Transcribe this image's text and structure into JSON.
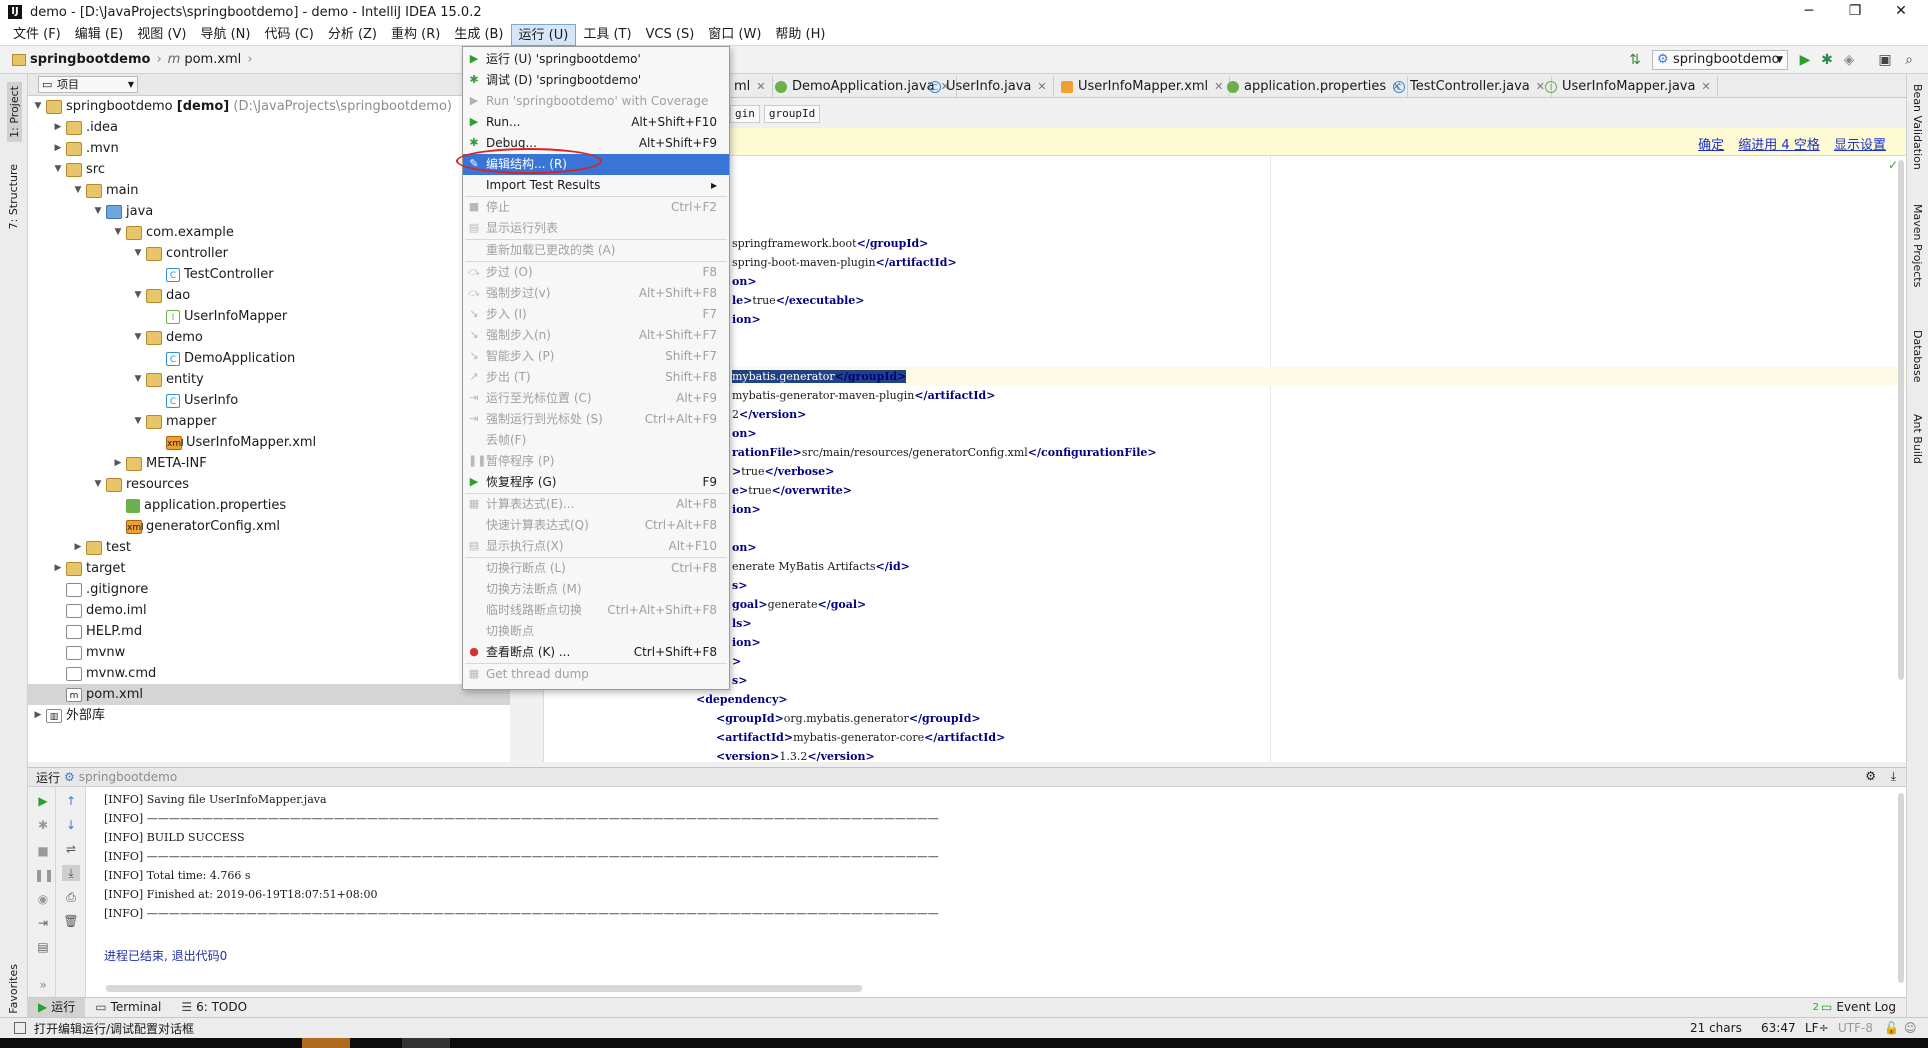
{
  "window": {
    "title": "demo - [D:\\JavaProjects\\springbootdemo] - demo - IntelliJ IDEA 15.0.2",
    "minimize": "─",
    "maximize": "❐",
    "close": "✕"
  },
  "menubar": [
    "文件 (F)",
    "编辑 (E)",
    "视图 (V)",
    "导航 (N)",
    "代码 (C)",
    "分析 (Z)",
    "重构 (R)",
    "生成 (B)",
    "运行 (U)",
    "工具 (T)",
    "VCS (S)",
    "窗口 (W)",
    "帮助 (H)"
  ],
  "navbar": {
    "project": "springbootdemo",
    "file_icon": "m",
    "file": "pom.xml",
    "run_config": "springbootdemo"
  },
  "project_panel": {
    "header": "项目",
    "root_name": "springbootdemo",
    "root_module": "[demo]",
    "root_path": "(D:\\JavaProjects\\springbootdemo)",
    "items": [
      {
        "label": ".idea",
        "depth": 1,
        "arrow": "▶",
        "icon": "folder"
      },
      {
        "label": ".mvn",
        "depth": 1,
        "arrow": "▶",
        "icon": "folder"
      },
      {
        "label": "src",
        "depth": 1,
        "arrow": "▼",
        "icon": "folder"
      },
      {
        "label": "main",
        "depth": 2,
        "arrow": "▼",
        "icon": "folder"
      },
      {
        "label": "java",
        "depth": 3,
        "arrow": "▼",
        "icon": "folder-blue"
      },
      {
        "label": "com.example",
        "depth": 4,
        "arrow": "▼",
        "icon": "folder"
      },
      {
        "label": "controller",
        "depth": 5,
        "arrow": "▼",
        "icon": "folder"
      },
      {
        "label": "TestController",
        "depth": 6,
        "arrow": "",
        "icon": "class"
      },
      {
        "label": "dao",
        "depth": 5,
        "arrow": "▼",
        "icon": "folder"
      },
      {
        "label": "UserInfoMapper",
        "depth": 6,
        "arrow": "",
        "icon": "interface"
      },
      {
        "label": "demo",
        "depth": 5,
        "arrow": "▼",
        "icon": "folder"
      },
      {
        "label": "DemoApplication",
        "depth": 6,
        "arrow": "",
        "icon": "class"
      },
      {
        "label": "entity",
        "depth": 5,
        "arrow": "▼",
        "icon": "folder"
      },
      {
        "label": "UserInfo",
        "depth": 6,
        "arrow": "",
        "icon": "class"
      },
      {
        "label": "mapper",
        "depth": 5,
        "arrow": "▼",
        "icon": "folder"
      },
      {
        "label": "UserInfoMapper.xml",
        "depth": 6,
        "arrow": "",
        "icon": "xml"
      },
      {
        "label": "META-INF",
        "depth": 4,
        "arrow": "▶",
        "icon": "folder"
      },
      {
        "label": "resources",
        "depth": 3,
        "arrow": "▼",
        "icon": "folder"
      },
      {
        "label": "application.properties",
        "depth": 4,
        "arrow": "",
        "icon": "spring"
      },
      {
        "label": "generatorConfig.xml",
        "depth": 4,
        "arrow": "",
        "icon": "xml"
      },
      {
        "label": "test",
        "depth": 2,
        "arrow": "▶",
        "icon": "folder"
      },
      {
        "label": "target",
        "depth": 1,
        "arrow": "▶",
        "icon": "folder"
      },
      {
        "label": ".gitignore",
        "depth": 1,
        "arrow": "",
        "icon": "file"
      },
      {
        "label": "demo.iml",
        "depth": 1,
        "arrow": "",
        "icon": "file"
      },
      {
        "label": "HELP.md",
        "depth": 1,
        "arrow": "",
        "icon": "file"
      },
      {
        "label": "mvnw",
        "depth": 1,
        "arrow": "",
        "icon": "file"
      },
      {
        "label": "mvnw.cmd",
        "depth": 1,
        "arrow": "",
        "icon": "file"
      },
      {
        "label": "pom.xml",
        "depth": 1,
        "arrow": "",
        "icon": "maven",
        "selected": true
      },
      {
        "label": "外部库",
        "depth": 0,
        "arrow": "▶",
        "icon": "library"
      }
    ]
  },
  "editor_tabs": [
    {
      "label": "ml",
      "icon": ""
    },
    {
      "label": "DemoApplication.java",
      "icon": "spring"
    },
    {
      "label": "UserInfo.java",
      "icon": "class"
    },
    {
      "label": "UserInfoMapper.xml",
      "icon": "xml"
    },
    {
      "label": "application.properties",
      "icon": "spring"
    },
    {
      "label": "TestController.java",
      "icon": "class"
    },
    {
      "label": "UserInfoMapper.java",
      "icon": "interface"
    }
  ],
  "editor_breadcrumb": [
    "gin",
    "groupId"
  ],
  "infobar": {
    "confirm": "确定",
    "indent": "缩进用 4 空格",
    "settings": "显示设置"
  },
  "code_lines": [
    {
      "pre": "springframework.boot",
      "tag": "</groupId>"
    },
    {
      "pre": "spring-boot-maven-plugin",
      "tag": "</artifactId>"
    },
    {
      "pre": "",
      "tag": "on>"
    },
    {
      "pre": "",
      "tag": "le>",
      "mid": "true",
      "tag2": "</executable>"
    },
    {
      "pre": "",
      "tag": "ion>"
    },
    {
      "pre": "",
      "tag": ""
    },
    {
      "pre": "",
      "tag": ""
    },
    {
      "sel": "mybatis.generator",
      "tag": "</groupId>"
    },
    {
      "pre": "mybatis-generator-maven-plugin",
      "tag": "</artifactId>"
    },
    {
      "pre": "2",
      "tag": "</version>"
    },
    {
      "pre": "",
      "tag": "on>"
    },
    {
      "tag": "rationFile>",
      "mid": "src/main/resources/generatorConfig.xml",
      "tag2": "</configurationFile>"
    },
    {
      "tag": ">",
      "mid": "true",
      "tag2": "</verbose>"
    },
    {
      "tag": "e>",
      "mid": "true",
      "tag2": "</overwrite>"
    },
    {
      "tag": "ion>"
    },
    {
      "tag": ""
    },
    {
      "tag": "on>"
    },
    {
      "pre": "enerate MyBatis Artifacts",
      "tag": "</id>"
    },
    {
      "tag": "s>"
    },
    {
      "tag": "goal>",
      "mid": "generate",
      "tag2": "</goal>"
    },
    {
      "tag": "ls>"
    },
    {
      "tag": "ion>"
    },
    {
      "tag": ">"
    },
    {
      "tag": "s>"
    },
    {
      "indent": 2,
      "tag": "<dependency>"
    },
    {
      "indent": 3,
      "tag": "<groupId>",
      "mid": "org.mybatis.generator",
      "tag2": "</groupId>"
    },
    {
      "indent": 3,
      "tag": "<artifactId>",
      "mid": "mybatis-generator-core",
      "tag2": "</artifactId>"
    },
    {
      "indent": 3,
      "tag": "<version>",
      "mid": "1.3.2",
      "tag2": "</version>"
    }
  ],
  "run_menu": [
    {
      "label": "运行 (U) 'springbootdemo'",
      "shortcut": "",
      "icon": "▶",
      "icolor": "#2aa02a",
      "dis": false
    },
    {
      "label": "调试 (D) 'springbootdemo'",
      "shortcut": "",
      "icon": "✱",
      "icolor": "#3a9a3a",
      "dis": false
    },
    {
      "label": "Run 'springbootdemo' with Coverage",
      "shortcut": "",
      "icon": "▶",
      "icolor": "#b0b0b0",
      "dis": true
    },
    {
      "label": "Run...",
      "shortcut": "Alt+Shift+F10",
      "icon": "▶",
      "icolor": "#2aa02a",
      "dis": false
    },
    {
      "label": "Debug...",
      "shortcut": "Alt+Shift+F9",
      "icon": "✱",
      "icolor": "#3a9a3a",
      "dis": false
    },
    {
      "label": "编辑结构... (R)",
      "shortcut": "",
      "icon": "✎",
      "icolor": "#ffffff",
      "dis": false,
      "hl": true
    },
    {
      "label": "Import Test Results",
      "shortcut": "",
      "icon": "",
      "icolor": "",
      "dis": false,
      "submenu": "▸",
      "sepAfter": true
    },
    {
      "label": "停止",
      "shortcut": "Ctrl+F2",
      "icon": "■",
      "icolor": "#b8b8b8",
      "dis": true
    },
    {
      "label": "显示运行列表",
      "shortcut": "",
      "icon": "▤",
      "icolor": "#b8b8b8",
      "dis": true,
      "sepAfter": true
    },
    {
      "label": "重新加载已更改的类 (A)",
      "shortcut": "",
      "icon": "",
      "icolor": "",
      "dis": true,
      "sepAfter": true
    },
    {
      "label": "步过 (O)",
      "shortcut": "F8",
      "icon": "⤼",
      "icolor": "#b8b8b8",
      "dis": true
    },
    {
      "label": "强制步过(v)",
      "shortcut": "Alt+Shift+F8",
      "icon": "⤼",
      "icolor": "#b8b8b8",
      "dis": true
    },
    {
      "label": "步入 (I)",
      "shortcut": "F7",
      "icon": "↘",
      "icolor": "#b8b8b8",
      "dis": true
    },
    {
      "label": "强制步入(n)",
      "shortcut": "Alt+Shift+F7",
      "icon": "↘",
      "icolor": "#b8b8b8",
      "dis": true
    },
    {
      "label": "智能步入 (P)",
      "shortcut": "Shift+F7",
      "icon": "↘",
      "icolor": "#b8b8b8",
      "dis": true
    },
    {
      "label": "步出 (T)",
      "shortcut": "Shift+F8",
      "icon": "↗",
      "icolor": "#b8b8b8",
      "dis": true
    },
    {
      "label": "运行至光标位置 (C)",
      "shortcut": "Alt+F9",
      "icon": "⇥",
      "icolor": "#b8b8b8",
      "dis": true
    },
    {
      "label": "强制运行到光标处 (S)",
      "shortcut": "Ctrl+Alt+F9",
      "icon": "⇥",
      "icolor": "#b8b8b8",
      "dis": true
    },
    {
      "label": "丢帧(F)",
      "shortcut": "",
      "icon": "",
      "icolor": "",
      "dis": true
    },
    {
      "label": "暂停程序 (P)",
      "shortcut": "",
      "icon": "❚❚",
      "icolor": "#b8b8b8",
      "dis": true
    },
    {
      "label": "恢复程序 (G)",
      "shortcut": "F9",
      "icon": "▶",
      "icolor": "#2aa02a",
      "dis": false,
      "sepAfter": true
    },
    {
      "label": "计算表达式(E)...",
      "shortcut": "Alt+F8",
      "icon": "▦",
      "icolor": "#b8b8b8",
      "dis": true
    },
    {
      "label": "快速计算表达式(Q)",
      "shortcut": "Ctrl+Alt+F8",
      "icon": "",
      "icolor": "",
      "dis": true
    },
    {
      "label": "显示执行点(X)",
      "shortcut": "Alt+F10",
      "icon": "▤",
      "icolor": "#b8b8b8",
      "dis": true,
      "sepAfter": true
    },
    {
      "label": "切换行断点 (L)",
      "shortcut": "Ctrl+F8",
      "icon": "",
      "icolor": "",
      "dis": true
    },
    {
      "label": "切换方法断点 (M)",
      "shortcut": "",
      "icon": "",
      "icolor": "",
      "dis": true
    },
    {
      "label": "临时线路断点切换",
      "shortcut": "Ctrl+Alt+Shift+F8",
      "icon": "",
      "icolor": "",
      "dis": true
    },
    {
      "label": "切换断点",
      "shortcut": "",
      "icon": "",
      "icolor": "",
      "dis": true
    },
    {
      "label": "查看断点 (K) ...",
      "shortcut": "Ctrl+Shift+F8",
      "icon": "●",
      "icolor": "#d83030",
      "dis": false,
      "sepAfter": true
    },
    {
      "label": "Get thread dump",
      "shortcut": "",
      "icon": "▦",
      "icolor": "#b8b8b8",
      "dis": true
    }
  ],
  "run_panel": {
    "title": "运行",
    "config": "springbootdemo",
    "lines": [
      "[INFO] Saving file UserInfoMapper.java",
      "[INFO] ————————————————————————————————————————————————————————————————————————",
      "[INFO] BUILD SUCCESS",
      "[INFO] ————————————————————————————————————————————————————————————————————————",
      "[INFO] Total time:  4.766 s",
      "[INFO] Finished at: 2019-06-19T18:07:51+08:00",
      "[INFO] ————————————————————————————————————————————————————————————————————————"
    ],
    "exit_msg": "进程已结束, 退出代码0"
  },
  "bottom_tabs": {
    "run": "运行",
    "terminal": "Terminal",
    "todo": "6: TODO",
    "event_log": "Event Log",
    "event_count": "2"
  },
  "status": {
    "message": "打开编辑运行/调试配置对话框",
    "chars": "21 chars",
    "position": "63:47",
    "line_sep": "LF÷",
    "encoding": "UTF-8"
  },
  "left_tabs": {
    "project": "1: Project",
    "structure": "7: Structure",
    "favorites": "2: Favorites"
  },
  "right_tabs": {
    "bean": "Bean Validation",
    "maven": "Maven Projects",
    "database": "Database",
    "ant": "Ant Build"
  }
}
